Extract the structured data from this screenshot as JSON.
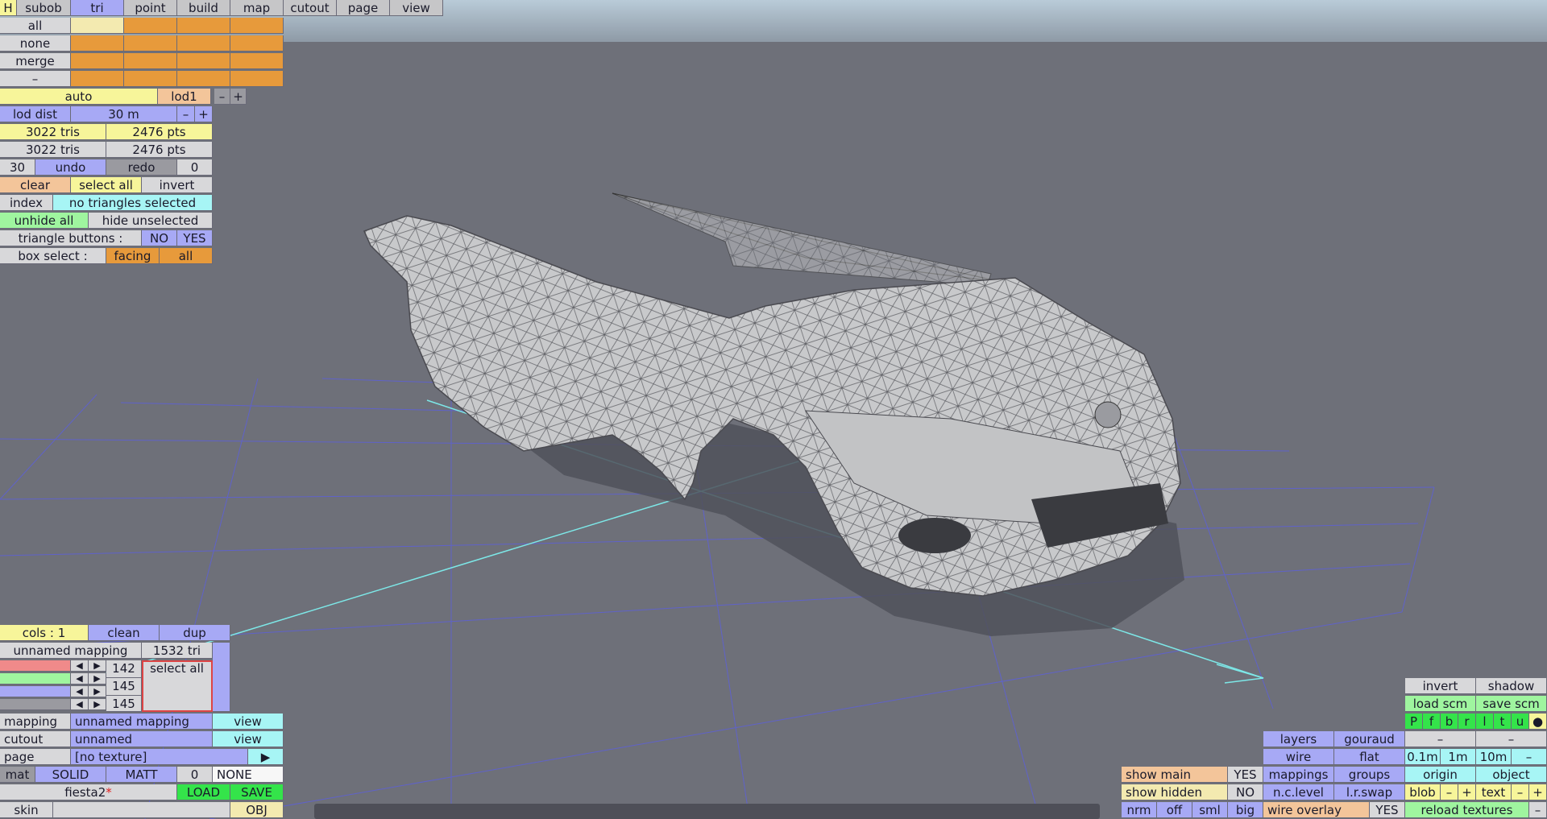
{
  "top_menu": {
    "h": "H",
    "subob": "subob",
    "tri": "tri",
    "point": "point",
    "build": "build",
    "map": "map",
    "cutout": "cutout",
    "page": "page",
    "view": "view"
  },
  "select_rows": {
    "all": "all",
    "none": "none",
    "merge": "merge",
    "dash": "–"
  },
  "lod": {
    "auto": "auto",
    "lod1": "lod1",
    "minus": "–",
    "plus": "+",
    "dist_label": "lod dist",
    "dist_value": "30 m"
  },
  "counts": {
    "tris1": "3022 tris",
    "pts1": "2476 pts",
    "tris2": "3022 tris",
    "pts2": "2476 pts"
  },
  "history": {
    "count": "30",
    "undo": "undo",
    "redo": "redo",
    "zero": "0"
  },
  "selection": {
    "clear": "clear",
    "select_all": "select all",
    "invert": "invert",
    "index": "index",
    "status": "no triangles selected",
    "unhide_all": "unhide all",
    "hide_unselected": "hide unselected",
    "tri_buttons_label": "triangle buttons :",
    "no": "NO",
    "yes": "YES",
    "box_select_label": "box select :",
    "facing": "facing",
    "all": "all"
  },
  "mapping_panel": {
    "cols": "cols : 1",
    "clean": "clean",
    "dup": "dup",
    "mapping_name": "unnamed mapping",
    "tri_count": "1532 tri",
    "v1": "142",
    "v2": "145",
    "v3": "145",
    "select_all": "select all",
    "left": "◀",
    "right": "▶"
  },
  "props": {
    "mapping_label": "mapping",
    "mapping_value": "unnamed mapping",
    "view1": "view",
    "cutout_label": "cutout",
    "cutout_value": "unnamed",
    "view2": "view",
    "page_label": "page",
    "page_value": "[no texture]",
    "play": "▶",
    "mat": "mat",
    "solid": "SOLID",
    "matt": "MATT",
    "mat_zero": "0",
    "none": "NONE",
    "filename": "fiesta2",
    "load": "LOAD",
    "save": "SAVE",
    "skin": "skin",
    "obj": "OBJ"
  },
  "view_panel": {
    "invert": "invert",
    "shadow": "shadow",
    "load_scm": "load scm",
    "save_scm": "save scm",
    "flags": [
      "P",
      "f",
      "b",
      "r",
      "l",
      "t",
      "u",
      "●"
    ],
    "dash": "–",
    "layers": "layers",
    "gouraud": "gouraud",
    "wire": "wire",
    "flat": "flat",
    "d1": "0.1m",
    "d2": "1m",
    "d3": "10m",
    "mappings": "mappings",
    "groups": "groups",
    "origin": "origin",
    "object": "object",
    "ncl": "n.c.level",
    "lrswap": "l.r.swap",
    "blob": "blob",
    "text": "text",
    "plus": "+",
    "reload": "reload textures"
  },
  "show_panel": {
    "show_main": "show main",
    "yes": "YES",
    "show_hidden": "show hidden",
    "no": "NO",
    "nrm": "nrm",
    "off": "off",
    "sml": "sml",
    "big": "big",
    "wire_overlay": "wire overlay",
    "wo_yes": "YES"
  },
  "colors": {
    "blue": "#a7a9f5",
    "cyan": "#a7f5f5",
    "yellow": "#f7f59a",
    "orange": "#e79a3b",
    "green": "#9ff59f",
    "viewport": "#6e7079",
    "grid": "#5d60d8",
    "axis": "#7de8e8"
  }
}
